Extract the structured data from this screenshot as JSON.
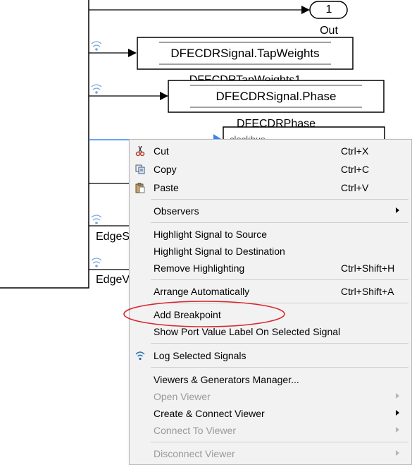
{
  "diagram": {
    "out_port_number": "1",
    "out_port_label": "Out",
    "blocks": [
      {
        "text": "DFECDRSignal.TapWeights"
      },
      {
        "text": "DFECDRSignal.Phase"
      }
    ],
    "block_names": [
      "DFECDRTapWeights1",
      "DFECDRPhase"
    ],
    "partial_block_text": "clockbus",
    "signal_labels": [
      "EdgeS",
      "EdgeV"
    ]
  },
  "context_menu": {
    "items": [
      {
        "label": "Cut",
        "shortcut": "Ctrl+X",
        "icon": "scissors-icon"
      },
      {
        "label": "Copy",
        "shortcut": "Ctrl+C",
        "icon": "copy-icon"
      },
      {
        "label": "Paste",
        "shortcut": "Ctrl+V",
        "icon": "clipboard-icon"
      },
      {
        "label": "Observers",
        "has_submenu": true
      },
      {
        "label": "Highlight Signal to Source"
      },
      {
        "label": "Highlight Signal to Destination"
      },
      {
        "label": "Remove Highlighting",
        "shortcut": "Ctrl+Shift+H"
      },
      {
        "label": "Arrange Automatically",
        "shortcut": "Ctrl+Shift+A"
      },
      {
        "label": "Add Breakpoint",
        "highlighted_with_circle": true
      },
      {
        "label": "Show Port Value Label On Selected Signal"
      },
      {
        "label": "Log Selected Signals",
        "icon": "log-signal-icon"
      },
      {
        "label": "Viewers & Generators Manager..."
      },
      {
        "label": "Open Viewer",
        "disabled": true,
        "has_submenu": true
      },
      {
        "label": "Create & Connect Viewer",
        "has_submenu": true
      },
      {
        "label": "Connect To Viewer",
        "disabled": true,
        "has_submenu": true
      },
      {
        "label": "Disconnect Viewer",
        "disabled": true,
        "has_submenu": true
      }
    ]
  },
  "colors": {
    "menu_background": "#f2f2f2",
    "annotation_circle": "#d9262e",
    "logging_icon": "#1f6fb5",
    "selected_signal": "#3b82f6"
  }
}
